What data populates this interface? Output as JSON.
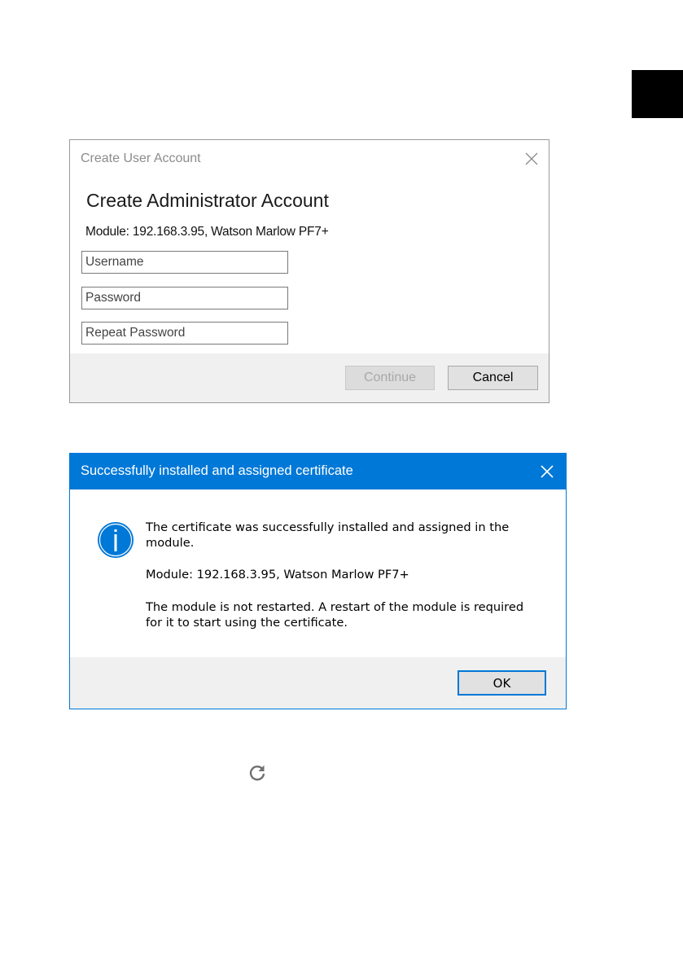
{
  "create_user_dialog": {
    "window_title": "Create User Account",
    "heading": "Create Administrator Account",
    "module_info": "Module: 192.168.3.95, Watson Marlow PF7+",
    "username_placeholder": "Username",
    "password_placeholder": "Password",
    "repeat_password_placeholder": "Repeat Password",
    "continue_label": "Continue",
    "cancel_label": "Cancel",
    "close_icon": "close-icon"
  },
  "certificate_dialog": {
    "window_title": "Successfully installed and assigned certificate",
    "message_line1": "The certificate was successfully installed and assigned in the module.",
    "module_info": "Module: 192.168.3.95, Watson Marlow PF7+",
    "message_line3": "The module is not restarted. A restart of the module is required for it to start using the certificate.",
    "ok_label": "OK",
    "icon": "info-icon",
    "accent_color": "#0078d7"
  },
  "refresh_icon": "refresh-icon"
}
